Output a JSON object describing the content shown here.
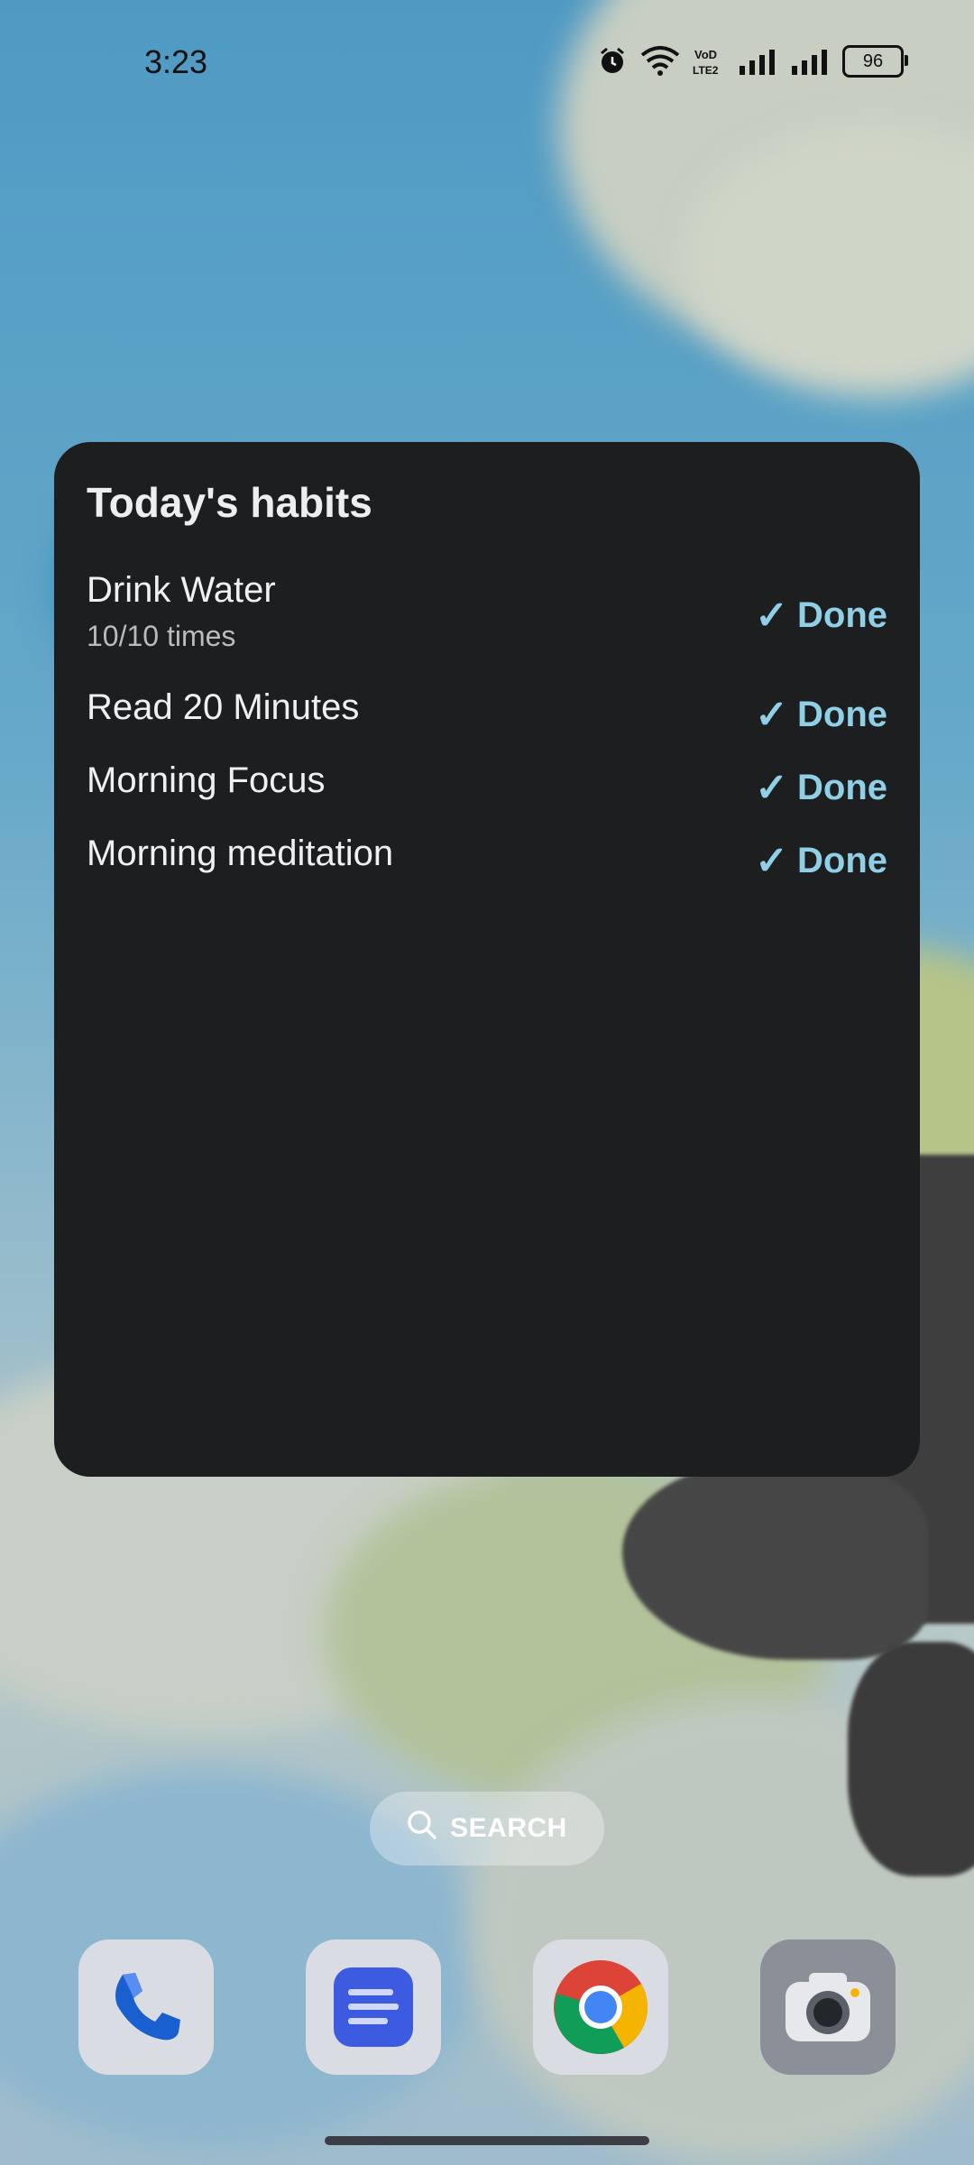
{
  "status_bar": {
    "time": "3:23",
    "battery": "96",
    "icons": [
      "alarm-icon",
      "wifi-icon",
      "volte-icon",
      "signal-1-icon",
      "signal-2-icon",
      "battery-icon"
    ],
    "volte_label": "VoLTE"
  },
  "widget": {
    "title": "Today's habits",
    "habits": [
      {
        "name": "Drink Water",
        "subtitle": "10/10 times",
        "status": "Done"
      },
      {
        "name": "Read 20 Minutes",
        "status": "Done"
      },
      {
        "name": "Morning Focus",
        "status": "Done"
      },
      {
        "name": "Morning meditation",
        "status": "Done"
      }
    ],
    "check_glyph": "✓"
  },
  "search": {
    "label": "SEARCH"
  },
  "dock": {
    "apps": [
      "Phone",
      "Docs",
      "Chrome",
      "Camera"
    ]
  },
  "colors": {
    "widget_bg": "#1c1e20",
    "done_accent": "#8fd0e6"
  }
}
